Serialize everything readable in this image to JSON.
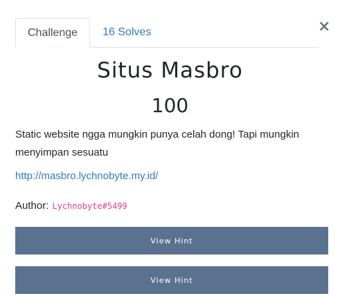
{
  "tabs": [
    {
      "label": "Challenge"
    },
    {
      "label": "16 Solves"
    }
  ],
  "close_symbol": "×",
  "challenge": {
    "name": "Situs Masbro",
    "value": "100",
    "description": "Static website ngga mungkin punya celah dong! Tapi mungkin menyimpan sesuatu",
    "link": "http://masbro.lychnobyte.my.id/",
    "author_label": "Author:",
    "author_handle": "Lychnobyte#5499"
  },
  "hints": [
    {
      "label": "View Hint"
    },
    {
      "label": "View Hint"
    }
  ],
  "colors": {
    "tab_link": "#337ab7",
    "button_bg": "#5b7190",
    "author_code": "#e83e8c"
  }
}
